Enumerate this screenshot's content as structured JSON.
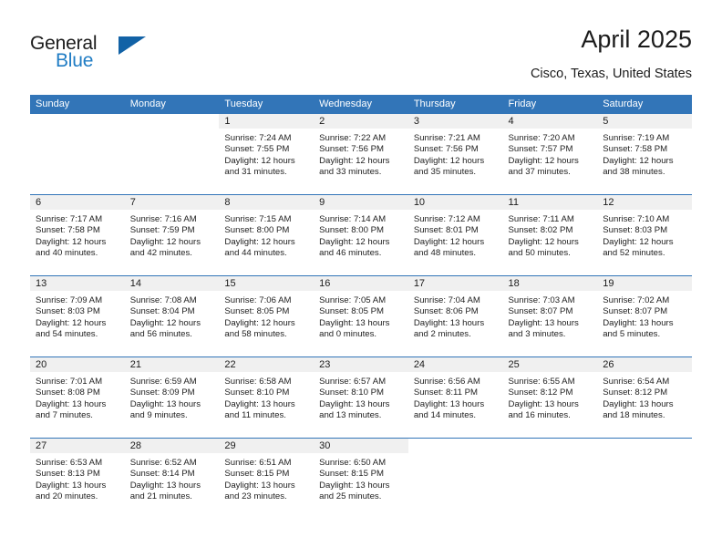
{
  "brand": {
    "name_part1": "General",
    "name_part2": "Blue",
    "logo_icon": "triangle-logo-icon"
  },
  "header": {
    "title": "April 2025",
    "location": "Cisco, Texas, United States"
  },
  "colors": {
    "header_blue": "#3275b8",
    "logo_blue": "#1f7cc4",
    "logo_triangle": "#1262a6",
    "daynum_band": "#f0f0f0",
    "text": "#1b1b1b"
  },
  "weekday_headers": [
    "Sunday",
    "Monday",
    "Tuesday",
    "Wednesday",
    "Thursday",
    "Friday",
    "Saturday"
  ],
  "weeks": [
    [
      {
        "day": "",
        "blank": true
      },
      {
        "day": "",
        "blank": true
      },
      {
        "day": "1",
        "sunrise": "Sunrise: 7:24 AM",
        "sunset": "Sunset: 7:55 PM",
        "daylight": "Daylight: 12 hours and 31 minutes."
      },
      {
        "day": "2",
        "sunrise": "Sunrise: 7:22 AM",
        "sunset": "Sunset: 7:56 PM",
        "daylight": "Daylight: 12 hours and 33 minutes."
      },
      {
        "day": "3",
        "sunrise": "Sunrise: 7:21 AM",
        "sunset": "Sunset: 7:56 PM",
        "daylight": "Daylight: 12 hours and 35 minutes."
      },
      {
        "day": "4",
        "sunrise": "Sunrise: 7:20 AM",
        "sunset": "Sunset: 7:57 PM",
        "daylight": "Daylight: 12 hours and 37 minutes."
      },
      {
        "day": "5",
        "sunrise": "Sunrise: 7:19 AM",
        "sunset": "Sunset: 7:58 PM",
        "daylight": "Daylight: 12 hours and 38 minutes."
      }
    ],
    [
      {
        "day": "6",
        "sunrise": "Sunrise: 7:17 AM",
        "sunset": "Sunset: 7:58 PM",
        "daylight": "Daylight: 12 hours and 40 minutes."
      },
      {
        "day": "7",
        "sunrise": "Sunrise: 7:16 AM",
        "sunset": "Sunset: 7:59 PM",
        "daylight": "Daylight: 12 hours and 42 minutes."
      },
      {
        "day": "8",
        "sunrise": "Sunrise: 7:15 AM",
        "sunset": "Sunset: 8:00 PM",
        "daylight": "Daylight: 12 hours and 44 minutes."
      },
      {
        "day": "9",
        "sunrise": "Sunrise: 7:14 AM",
        "sunset": "Sunset: 8:00 PM",
        "daylight": "Daylight: 12 hours and 46 minutes."
      },
      {
        "day": "10",
        "sunrise": "Sunrise: 7:12 AM",
        "sunset": "Sunset: 8:01 PM",
        "daylight": "Daylight: 12 hours and 48 minutes."
      },
      {
        "day": "11",
        "sunrise": "Sunrise: 7:11 AM",
        "sunset": "Sunset: 8:02 PM",
        "daylight": "Daylight: 12 hours and 50 minutes."
      },
      {
        "day": "12",
        "sunrise": "Sunrise: 7:10 AM",
        "sunset": "Sunset: 8:03 PM",
        "daylight": "Daylight: 12 hours and 52 minutes."
      }
    ],
    [
      {
        "day": "13",
        "sunrise": "Sunrise: 7:09 AM",
        "sunset": "Sunset: 8:03 PM",
        "daylight": "Daylight: 12 hours and 54 minutes."
      },
      {
        "day": "14",
        "sunrise": "Sunrise: 7:08 AM",
        "sunset": "Sunset: 8:04 PM",
        "daylight": "Daylight: 12 hours and 56 minutes."
      },
      {
        "day": "15",
        "sunrise": "Sunrise: 7:06 AM",
        "sunset": "Sunset: 8:05 PM",
        "daylight": "Daylight: 12 hours and 58 minutes."
      },
      {
        "day": "16",
        "sunrise": "Sunrise: 7:05 AM",
        "sunset": "Sunset: 8:05 PM",
        "daylight": "Daylight: 13 hours and 0 minutes."
      },
      {
        "day": "17",
        "sunrise": "Sunrise: 7:04 AM",
        "sunset": "Sunset: 8:06 PM",
        "daylight": "Daylight: 13 hours and 2 minutes."
      },
      {
        "day": "18",
        "sunrise": "Sunrise: 7:03 AM",
        "sunset": "Sunset: 8:07 PM",
        "daylight": "Daylight: 13 hours and 3 minutes."
      },
      {
        "day": "19",
        "sunrise": "Sunrise: 7:02 AM",
        "sunset": "Sunset: 8:07 PM",
        "daylight": "Daylight: 13 hours and 5 minutes."
      }
    ],
    [
      {
        "day": "20",
        "sunrise": "Sunrise: 7:01 AM",
        "sunset": "Sunset: 8:08 PM",
        "daylight": "Daylight: 13 hours and 7 minutes."
      },
      {
        "day": "21",
        "sunrise": "Sunrise: 6:59 AM",
        "sunset": "Sunset: 8:09 PM",
        "daylight": "Daylight: 13 hours and 9 minutes."
      },
      {
        "day": "22",
        "sunrise": "Sunrise: 6:58 AM",
        "sunset": "Sunset: 8:10 PM",
        "daylight": "Daylight: 13 hours and 11 minutes."
      },
      {
        "day": "23",
        "sunrise": "Sunrise: 6:57 AM",
        "sunset": "Sunset: 8:10 PM",
        "daylight": "Daylight: 13 hours and 13 minutes."
      },
      {
        "day": "24",
        "sunrise": "Sunrise: 6:56 AM",
        "sunset": "Sunset: 8:11 PM",
        "daylight": "Daylight: 13 hours and 14 minutes."
      },
      {
        "day": "25",
        "sunrise": "Sunrise: 6:55 AM",
        "sunset": "Sunset: 8:12 PM",
        "daylight": "Daylight: 13 hours and 16 minutes."
      },
      {
        "day": "26",
        "sunrise": "Sunrise: 6:54 AM",
        "sunset": "Sunset: 8:12 PM",
        "daylight": "Daylight: 13 hours and 18 minutes."
      }
    ],
    [
      {
        "day": "27",
        "sunrise": "Sunrise: 6:53 AM",
        "sunset": "Sunset: 8:13 PM",
        "daylight": "Daylight: 13 hours and 20 minutes."
      },
      {
        "day": "28",
        "sunrise": "Sunrise: 6:52 AM",
        "sunset": "Sunset: 8:14 PM",
        "daylight": "Daylight: 13 hours and 21 minutes."
      },
      {
        "day": "29",
        "sunrise": "Sunrise: 6:51 AM",
        "sunset": "Sunset: 8:15 PM",
        "daylight": "Daylight: 13 hours and 23 minutes."
      },
      {
        "day": "30",
        "sunrise": "Sunrise: 6:50 AM",
        "sunset": "Sunset: 8:15 PM",
        "daylight": "Daylight: 13 hours and 25 minutes."
      },
      {
        "day": "",
        "blank": true
      },
      {
        "day": "",
        "blank": true
      },
      {
        "day": "",
        "blank": true
      }
    ]
  ]
}
